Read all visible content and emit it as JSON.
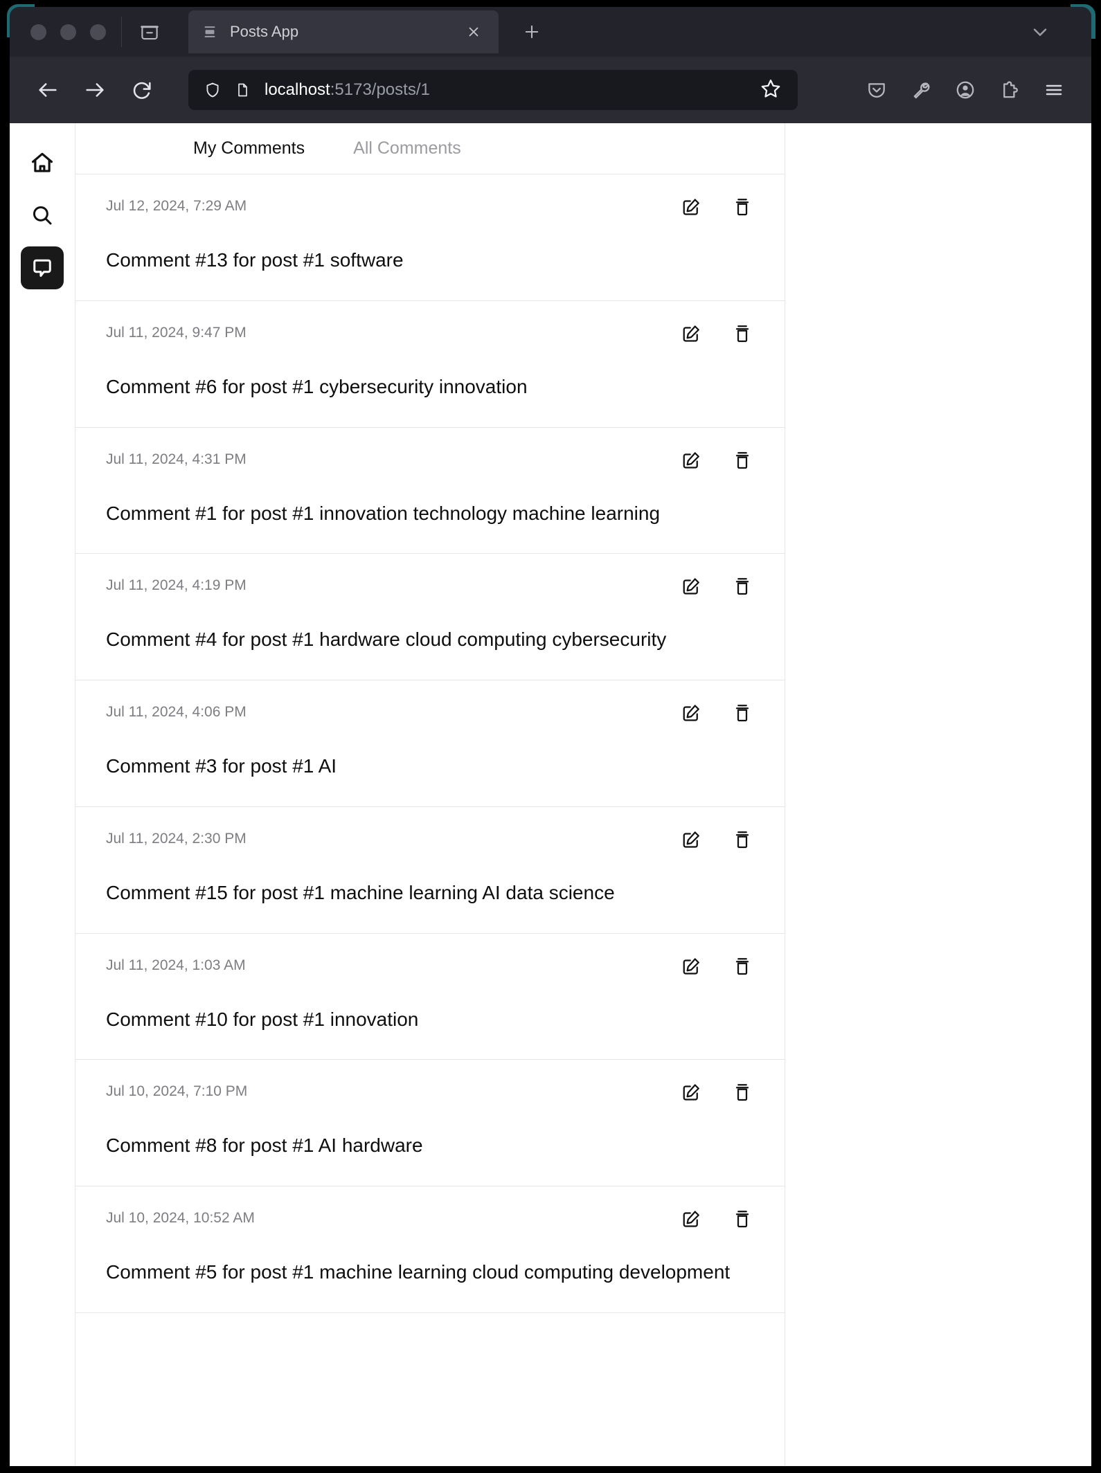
{
  "browser": {
    "tab": {
      "title": "Posts App",
      "favicon_icon": "page-layout-icon",
      "close_icon": "close-icon"
    },
    "new_tab_icon": "plus-icon",
    "list_all_tabs_icon": "chevron-down-icon",
    "firefox_view_icon": "firefox-view-icon",
    "nav": {
      "back_icon": "back-arrow-icon",
      "forward_icon": "forward-arrow-icon",
      "reload_icon": "reload-icon"
    },
    "url": {
      "host": "localhost",
      "path": ":5173/posts/1",
      "full": "localhost:5173/posts/1",
      "shield_icon": "shield-icon",
      "page_icon": "page-icon",
      "bookmark_icon": "star-icon"
    },
    "toolbar_icons": [
      "pocket-icon",
      "wrench-icon",
      "account-icon",
      "extensions-icon",
      "hamburger-menu-icon"
    ],
    "window_controls": [
      "close-dot",
      "minimize-dot",
      "maximize-dot"
    ]
  },
  "app": {
    "sidebar": {
      "items": [
        {
          "name": "home",
          "icon": "home-icon",
          "active": false
        },
        {
          "name": "search",
          "icon": "search-icon",
          "active": false
        },
        {
          "name": "comments",
          "icon": "comment-bubble-icon",
          "active": true
        }
      ]
    },
    "tabs": [
      {
        "label": "My Comments",
        "active": true
      },
      {
        "label": "All Comments",
        "active": false
      }
    ],
    "card_actions": {
      "edit_icon": "edit-pencil-icon",
      "delete_icon": "trash-icon"
    },
    "comments": [
      {
        "date": "Jul 12, 2024, 7:29 AM",
        "text": "Comment #13 for post #1 software"
      },
      {
        "date": "Jul 11, 2024, 9:47 PM",
        "text": "Comment #6 for post #1 cybersecurity innovation"
      },
      {
        "date": "Jul 11, 2024, 4:31 PM",
        "text": "Comment #1 for post #1 innovation technology machine learning"
      },
      {
        "date": "Jul 11, 2024, 4:19 PM",
        "text": "Comment #4 for post #1 hardware cloud computing cybersecurity"
      },
      {
        "date": "Jul 11, 2024, 4:06 PM",
        "text": "Comment #3 for post #1 AI"
      },
      {
        "date": "Jul 11, 2024, 2:30 PM",
        "text": "Comment #15 for post #1 machine learning AI data science"
      },
      {
        "date": "Jul 11, 2024, 1:03 AM",
        "text": "Comment #10 for post #1 innovation"
      },
      {
        "date": "Jul 10, 2024, 7:10 PM",
        "text": "Comment #8 for post #1 AI hardware"
      },
      {
        "date": "Jul 10, 2024, 10:52 AM",
        "text": "Comment #5 for post #1 machine learning cloud computing development"
      }
    ]
  },
  "colors": {
    "window_chrome": "#22232b",
    "navbar": "#2a2b33",
    "urlbar": "#18191f",
    "active_sidebar": "#191919",
    "page_bg": "#ffffff",
    "border": "#e6e6e8",
    "muted_text": "#7d7d83",
    "body_text": "#0e0e0e"
  }
}
